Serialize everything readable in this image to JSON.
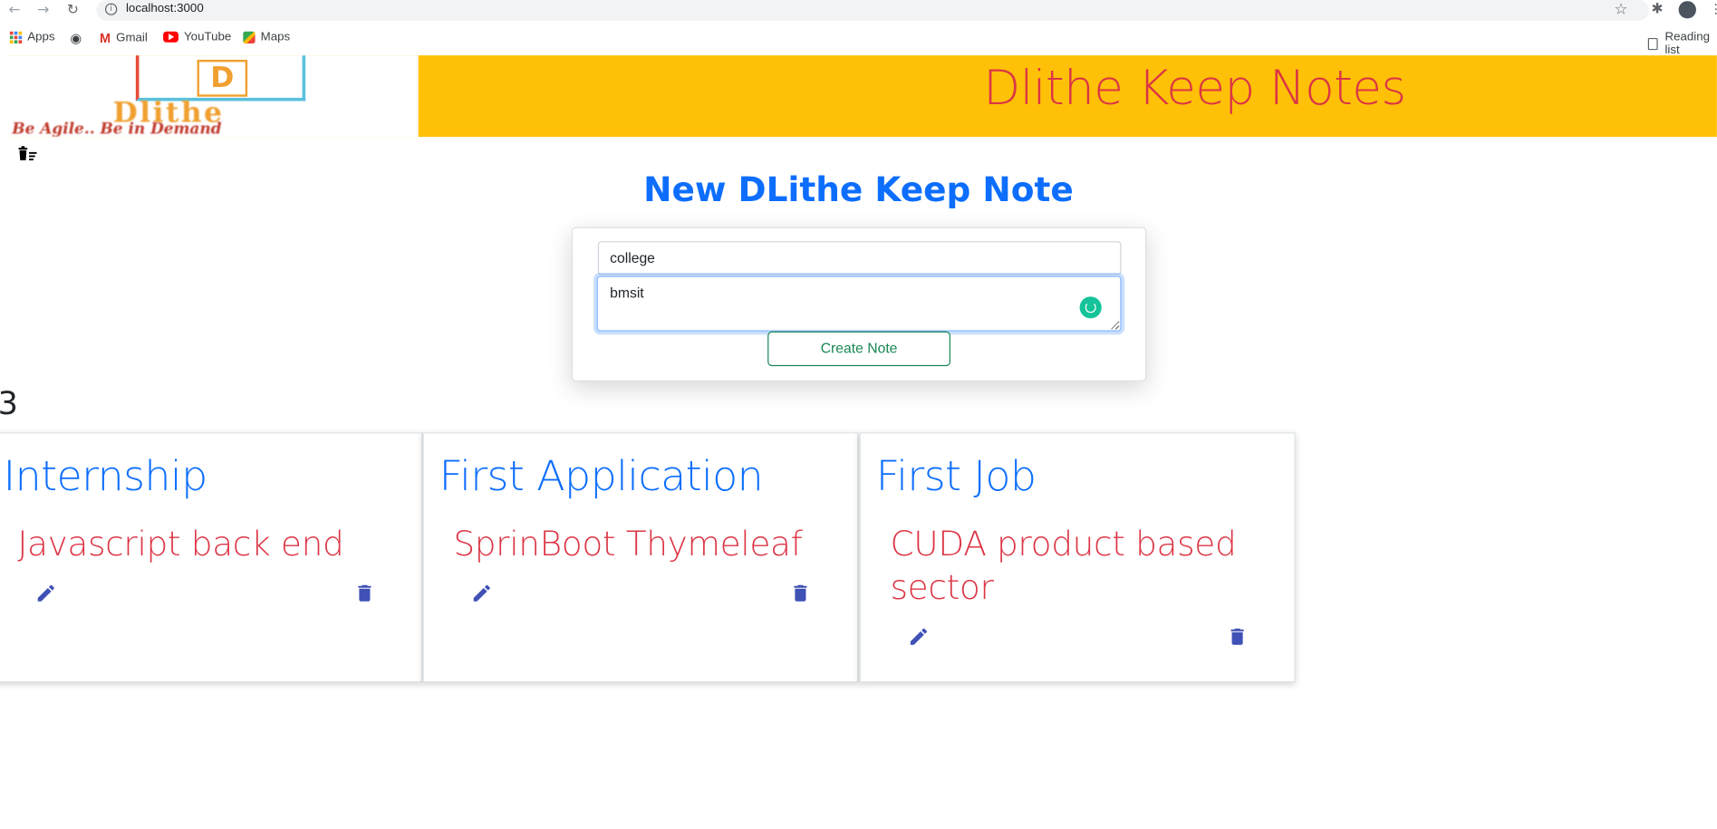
{
  "browser": {
    "url": "localhost:3000",
    "bookmarks": [
      "Apps",
      "Gmail",
      "YouTube",
      "Maps"
    ],
    "reading_list": "Reading list"
  },
  "header": {
    "title": "Dlithe Keep Notes",
    "logo_word": "Dlithe",
    "logo_letter": "D",
    "logo_tagline": "Be Agile.. Be in Demand"
  },
  "form": {
    "heading": "New DLithe Keep Note",
    "title_value": "college",
    "body_value": "bmsit",
    "submit_label": "Create Note"
  },
  "notes_count": "3",
  "notes": [
    {
      "title": "Internship",
      "body": "Javascript back end"
    },
    {
      "title": "First Application",
      "body": "SprinBoot Thymeleaf"
    },
    {
      "title": "First Job",
      "body": "CUDA product based sector"
    }
  ],
  "colors": {
    "header_bg": "#ffc107",
    "title_red": "#dc3545",
    "heading_blue": "#0d6efd",
    "icon_indigo": "#3f51b5",
    "create_green": "#198754"
  }
}
